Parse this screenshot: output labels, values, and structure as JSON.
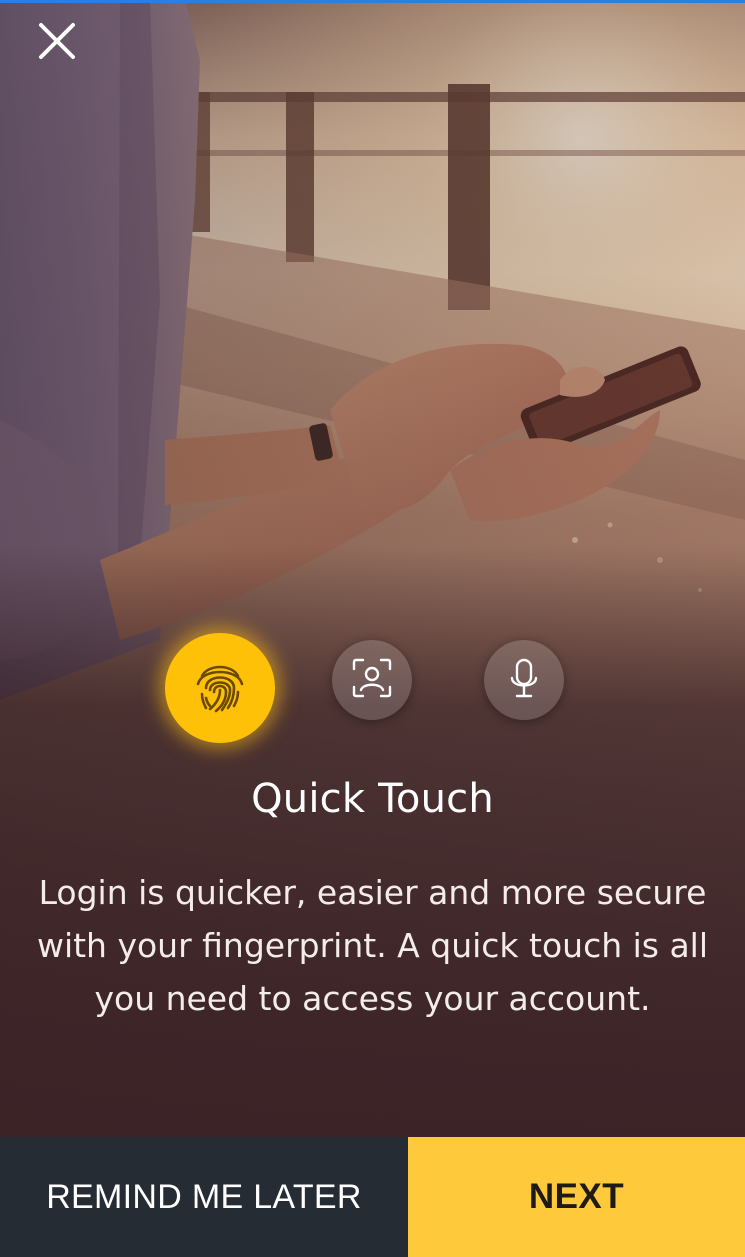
{
  "header": {
    "close_icon": "close-icon"
  },
  "auth_options": [
    {
      "icon": "fingerprint-icon",
      "state": "selected",
      "color": "#ffc107"
    },
    {
      "icon": "face-scan-icon",
      "state": "unselected"
    },
    {
      "icon": "microphone-icon",
      "state": "unselected"
    }
  ],
  "content": {
    "title": "Quick Touch",
    "description_lines": [
      "Login is quicker, easier and more secure",
      "with your fingerprint. A quick touch is all",
      "you need to access your account."
    ]
  },
  "footer": {
    "remind_label": "REMIND ME LATER",
    "next_label": "NEXT"
  },
  "colors": {
    "accent": "#ffc93c",
    "dark_button": "#262c34",
    "top_bar": "#2f7de1"
  }
}
